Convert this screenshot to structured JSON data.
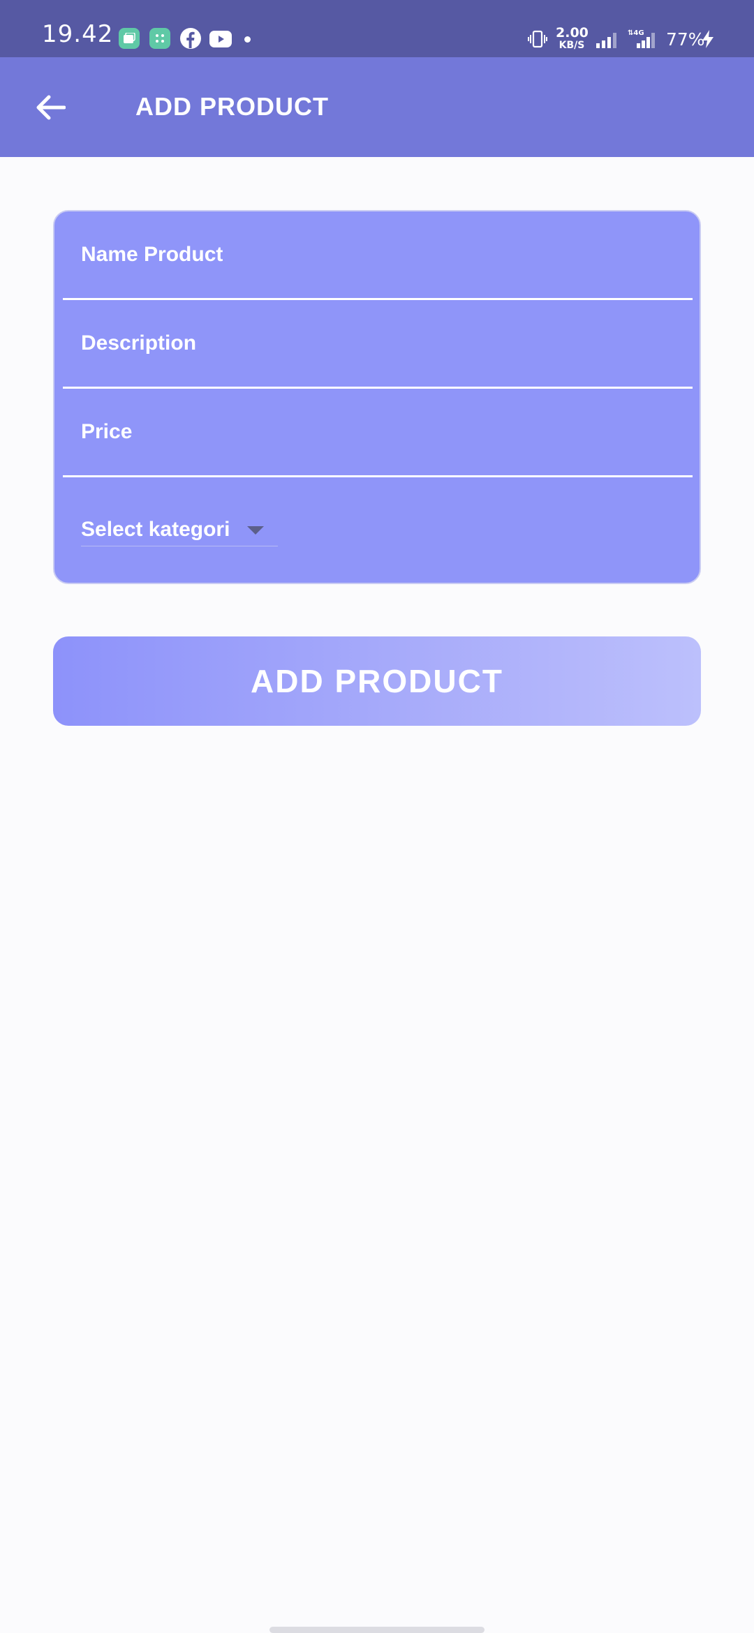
{
  "status_bar": {
    "time": "19.42",
    "net_speed_value": "2.00",
    "net_speed_unit": "KB/S",
    "battery": "77%",
    "icons": [
      "app-notification-icon",
      "app-notification-icon-2",
      "facebook-icon",
      "youtube-icon",
      "notification-dot",
      "vibrate-icon",
      "signal-icon",
      "signal-4g-icon",
      "charging-bolt-icon"
    ]
  },
  "app_bar": {
    "title": "ADD PRODUCT",
    "back_icon": "arrow-left-icon"
  },
  "form": {
    "name_placeholder": "Name Product",
    "description_placeholder": "Description",
    "price_placeholder": "Price",
    "category_select": "Select kategori"
  },
  "submit_label": "ADD PRODUCT",
  "colors": {
    "status_bar": "#5659a3",
    "app_bar": "#7378d9",
    "card": "#8f95f9",
    "background": "#fbfbfd"
  }
}
